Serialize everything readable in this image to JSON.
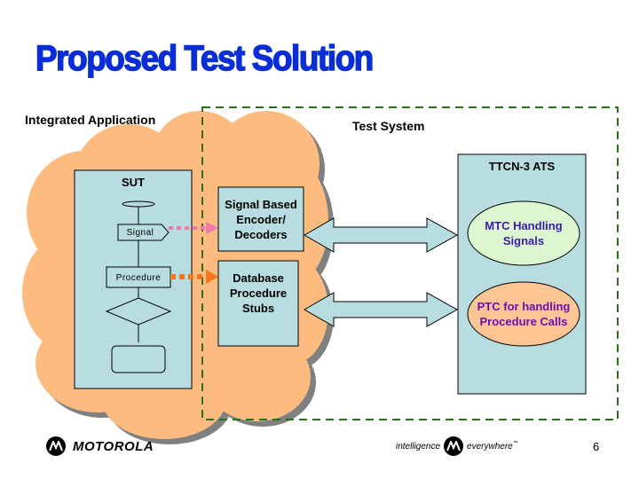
{
  "slide": {
    "title": "Proposed Test Solution",
    "page_number": "6"
  },
  "regions": {
    "integrated_application_label": "Integrated Application",
    "test_system_label": "Test System"
  },
  "sut": {
    "label": "SUT",
    "signal_label": "Signal",
    "procedure_label": "Procedure"
  },
  "adapters": {
    "encoder_label_line1": "Signal Based",
    "encoder_label_line2": "Encoder/",
    "encoder_label_line3": "Decoders",
    "stubs_label_line1": "Database",
    "stubs_label_line2": "Procedure",
    "stubs_label_line3": "Stubs"
  },
  "ats": {
    "label": "TTCN-3 ATS",
    "mtc_line1": "MTC Handling",
    "mtc_line2": "Signals",
    "ptc_line1": "PTC for handling",
    "ptc_line2": "Procedure Calls"
  },
  "footer": {
    "brand": "MOTOROLA",
    "tagline_left": "intelligence",
    "tagline_right": "everywhere",
    "trademark": "™"
  },
  "colors": {
    "title_blue": "#0a2ed6",
    "cloud_orange": "#fdbb80",
    "box_blue": "#b8dde0",
    "mtc_green": "#dcf7cf",
    "ptc_orange": "#fdc594",
    "mtc_text": "#3a1aa8",
    "ptc_text": "#6a10b0",
    "dashed_green": "#2d6e1e",
    "signal_arrow": "#f07ab0",
    "procedure_arrow": "#f47820"
  }
}
